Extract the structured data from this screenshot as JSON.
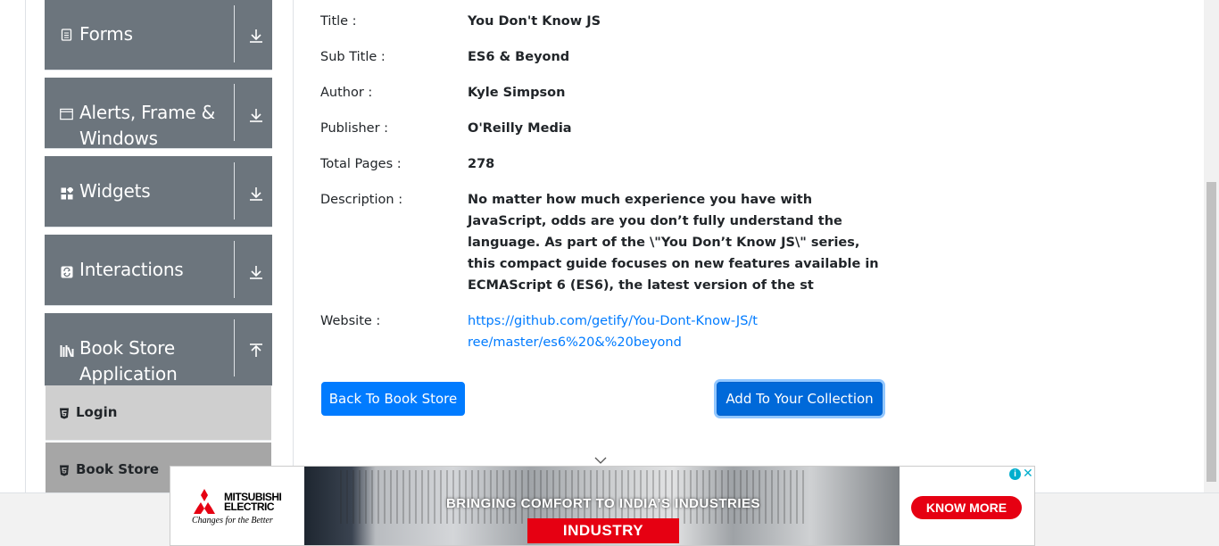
{
  "sidebar": {
    "groups": [
      {
        "label": "Forms",
        "icon": "form-icon",
        "arrow": "download-arrow-icon"
      },
      {
        "label": "Alerts, Frame & Windows",
        "icon": "window-icon",
        "arrow": "download-arrow-icon"
      },
      {
        "label": "Widgets",
        "icon": "widgets-icon",
        "arrow": "download-arrow-icon"
      },
      {
        "label": "Interactions",
        "icon": "interactions-icon",
        "arrow": "download-arrow-icon"
      },
      {
        "label": "Book Store Application",
        "icon": "books-icon",
        "arrow": "upload-arrow-icon"
      }
    ],
    "sub_items": [
      {
        "label": "Login",
        "icon": "html5-icon"
      },
      {
        "label": "Book Store",
        "icon": "html5-icon"
      }
    ]
  },
  "book": {
    "title_label": "Title :",
    "title": "You Don't Know JS",
    "subtitle_label": "Sub Title :",
    "subtitle": "ES6 & Beyond",
    "author_label": "Author :",
    "author": "Kyle Simpson",
    "publisher_label": "Publisher :",
    "publisher": "O'Reilly Media",
    "pages_label": "Total Pages :",
    "pages": "278",
    "description_label": "Description :",
    "description": "No matter how much experience you have with JavaScript, odds are you don’t fully understand the language. As part of the \\\"You Don’t Know JS\\\" series, this compact guide focuses on new features available in ECMAScript 6 (ES6), the latest version of the st",
    "website_label": "Website :",
    "website": "https://github.com/getify/You-Dont-Know-JS/tree/master/es6%20&%20beyond"
  },
  "actions": {
    "back_label": "Back To Book Store",
    "add_label": "Add To Your Collection"
  },
  "ad": {
    "brand_line1": "MITSUBISHI",
    "brand_line2": "ELECTRIC",
    "tagline": "Changes for the Better",
    "headline": "BRINGING COMFORT TO INDIA’S INDUSTRIES",
    "industry": "INDUSTRY",
    "cta": "KNOW MORE",
    "adchoice": "i",
    "close": "✕"
  },
  "colors": {
    "sidebar_group_bg": "#6c757d",
    "primary": "#007bff",
    "ad_red": "#e60012"
  }
}
